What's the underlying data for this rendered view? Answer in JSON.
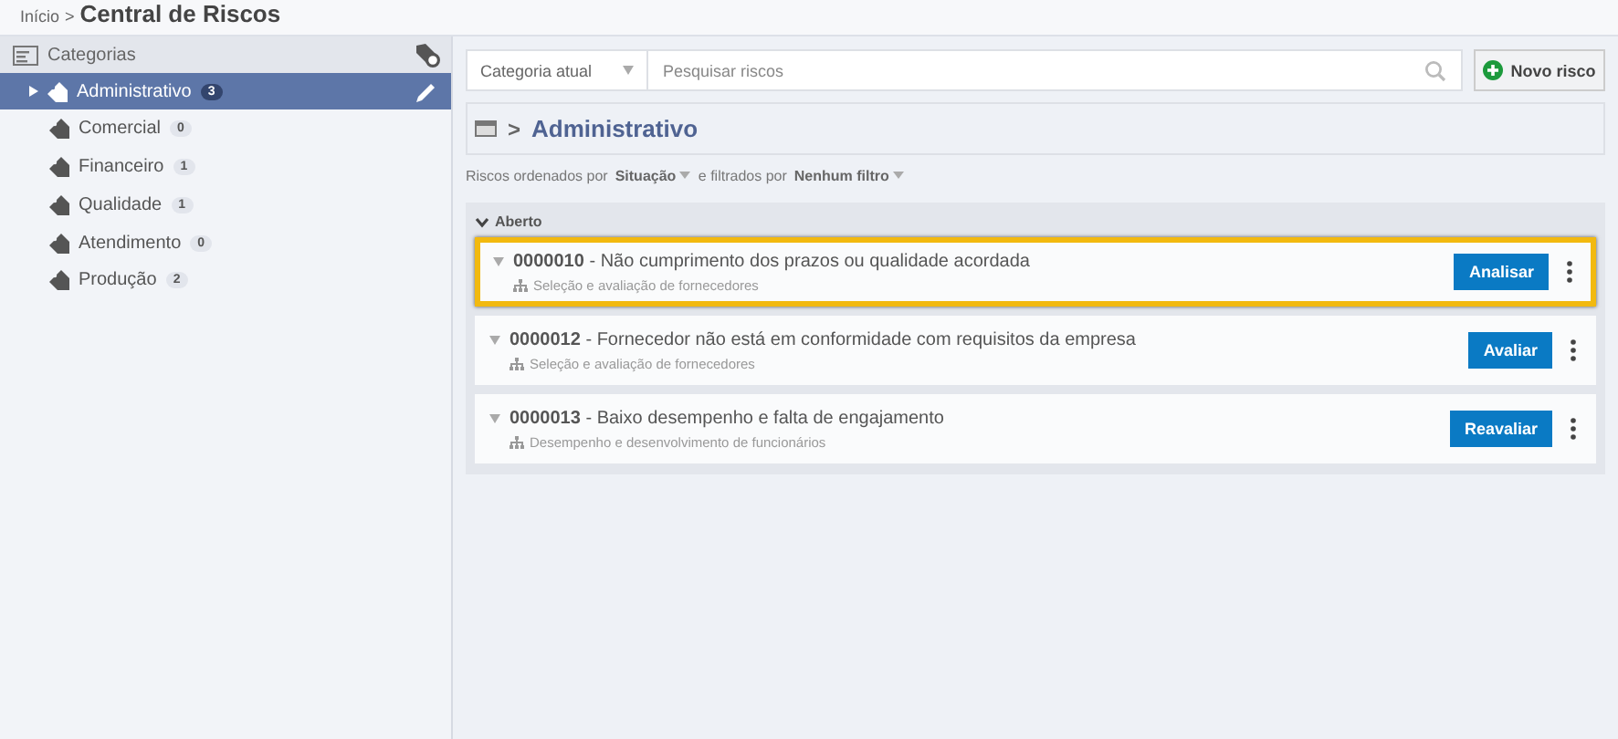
{
  "breadcrumb": {
    "parent": "Início",
    "separator": ">",
    "title": "Central de Riscos"
  },
  "sidebar": {
    "title": "Categorias",
    "items": [
      {
        "label": "Administrativo",
        "count": "3",
        "selected": true
      },
      {
        "label": "Comercial",
        "count": "0",
        "selected": false
      },
      {
        "label": "Financeiro",
        "count": "1",
        "selected": false
      },
      {
        "label": "Qualidade",
        "count": "1",
        "selected": false
      },
      {
        "label": "Atendimento",
        "count": "0",
        "selected": false
      },
      {
        "label": "Produção",
        "count": "2",
        "selected": false
      }
    ]
  },
  "toolbar": {
    "scope": "Categoria atual",
    "search": {
      "placeholder": "Pesquisar riscos"
    },
    "new_button": "Novo risco"
  },
  "header": {
    "separator": ">",
    "title": "Administrativo"
  },
  "sort_line": {
    "prefix": "Riscos ordenados por",
    "sort": "Situação",
    "middle": "e filtrados por",
    "filter": "Nenhum filtro"
  },
  "group": {
    "title": "Aberto",
    "expanded": true,
    "risks": [
      {
        "title": "**0000010** - Não cumprimento dos prazos ou qualidade acordada",
        "process": "Seleção e avaliação de fornecedores",
        "action": "Analisar",
        "highlighted": true
      },
      {
        "title": "**0000012** - Fornecedor não está em conformidade com requisitos da empresa",
        "process": "Seleção e avaliação de fornecedores",
        "action": "Avaliar",
        "highlighted": false
      },
      {
        "title": "**0000013** - Baixo desempenho e falta de engajamento",
        "process": "Desempenho e desenvolvimento de funcionários",
        "action": "Reavaliar",
        "highlighted": false
      }
    ]
  }
}
